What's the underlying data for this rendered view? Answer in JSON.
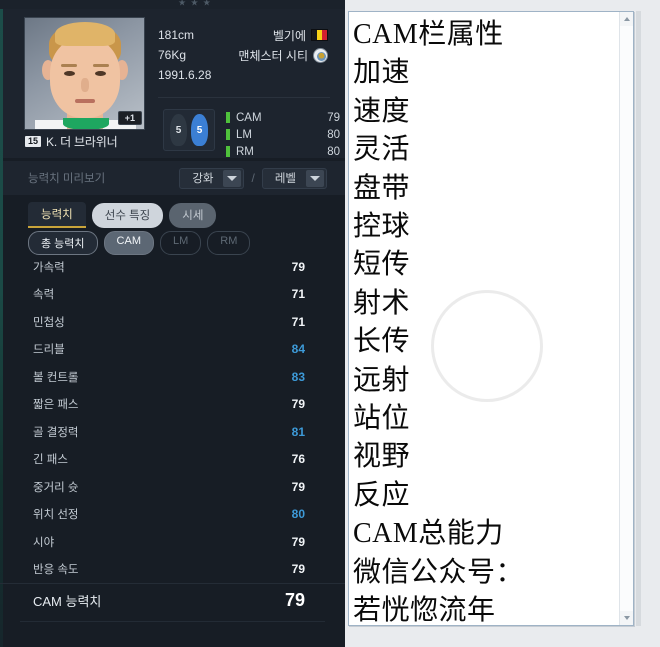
{
  "game": {
    "top_fragment": "٭ ٭ ٭",
    "player": {
      "name": "K. 더 브라위너",
      "jersey_number": "15",
      "upgrade_badge": "+1",
      "height": "181cm",
      "weight": "76Kg",
      "birthdate": "1991.6.28",
      "nationality": "벨기에",
      "club": "맨체스터 시티",
      "nationality_icon": "belgium-flag-icon",
      "club_icon": "manchester-city-crest-icon"
    },
    "feet": {
      "weak_foot": "5",
      "strong_foot": "5"
    },
    "positions": [
      {
        "name": "CAM",
        "value": "79"
      },
      {
        "name": "LM",
        "value": "80"
      },
      {
        "name": "RM",
        "value": "80"
      }
    ],
    "preview": {
      "label": "능력치 미리보기",
      "enhance_value": "강화",
      "separator": "/",
      "level_value": "레벨",
      "arrow_icon": "chevron-down-icon"
    },
    "main_tabs": [
      {
        "label": "능력치",
        "state": "active"
      },
      {
        "label": "선수 특징",
        "state": "inactive"
      },
      {
        "label": "시세",
        "state": "dim"
      }
    ],
    "position_tabs": [
      {
        "label": "총 능력치",
        "state": "sel"
      },
      {
        "label": "CAM",
        "state": "on"
      },
      {
        "label": "LM",
        "state": "off"
      },
      {
        "label": "RM",
        "state": "off"
      }
    ],
    "stats": [
      {
        "name": "가속력",
        "value": "79",
        "boosted": false
      },
      {
        "name": "속력",
        "value": "71",
        "boosted": false
      },
      {
        "name": "민첩성",
        "value": "71",
        "boosted": false
      },
      {
        "name": "드리블",
        "value": "84",
        "boosted": true
      },
      {
        "name": "볼 컨트롤",
        "value": "83",
        "boosted": true
      },
      {
        "name": "짧은 패스",
        "value": "79",
        "boosted": false
      },
      {
        "name": "골 결정력",
        "value": "81",
        "boosted": true
      },
      {
        "name": "긴 패스",
        "value": "76",
        "boosted": false
      },
      {
        "name": "중거리 슛",
        "value": "79",
        "boosted": false
      },
      {
        "name": "위치 선정",
        "value": "80",
        "boosted": true
      },
      {
        "name": "시야",
        "value": "79",
        "boosted": false
      },
      {
        "name": "반응 속도",
        "value": "79",
        "boosted": false
      }
    ],
    "total": {
      "name": "CAM 능력치",
      "value": "79"
    },
    "colors": {
      "panel_bg": "#171d25",
      "header_bg": "#1d242e",
      "boost_blue": "#3d9ad8",
      "position_bar_green": "#4fc23c",
      "active_tab_gold": "#c9a43a",
      "strong_foot_blue": "#3b7fd4"
    }
  },
  "document": {
    "lines": [
      "CAM栏属性",
      "加速",
      "速度",
      "灵活",
      "盘带",
      "控球",
      "短传",
      "射术",
      "长传",
      "远射",
      "站位",
      "视野",
      "反应",
      "CAM总能力",
      "微信公众号：",
      "若恍惚流年"
    ],
    "scrollbar": {
      "up_icon": "scroll-up-arrow-icon",
      "down_icon": "scroll-down-arrow-icon"
    }
  }
}
